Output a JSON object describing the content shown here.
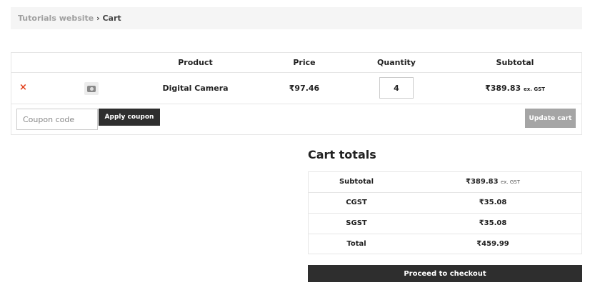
{
  "breadcrumb": {
    "home": "Tutorials website",
    "separator": "›",
    "current": "Cart"
  },
  "table": {
    "headers": {
      "product": "Product",
      "price": "Price",
      "quantity": "Quantity",
      "subtotal": "Subtotal"
    },
    "item": {
      "remove": "×",
      "thumbnail_icon": "camera-icon",
      "name": "Digital Camera",
      "price": "₹97.46",
      "quantity": "4",
      "subtotal": "₹389.83",
      "subtotal_suffix": "ex. GST"
    }
  },
  "actions": {
    "coupon_placeholder": "Coupon code",
    "apply_label": "Apply coupon",
    "update_label": "Update cart"
  },
  "totals": {
    "title": "Cart totals",
    "rows": [
      {
        "label": "Subtotal",
        "value": "₹389.83",
        "suffix": "ex. GST"
      },
      {
        "label": "CGST",
        "value": "₹35.08"
      },
      {
        "label": "SGST",
        "value": "₹35.08"
      },
      {
        "label": "Total",
        "value": "₹459.99"
      }
    ],
    "checkout_label": "Proceed to checkout"
  },
  "colors": {
    "remove": "#e2401c",
    "dark_button": "#2e2e2e",
    "disabled_button": "#a5a5a5"
  }
}
